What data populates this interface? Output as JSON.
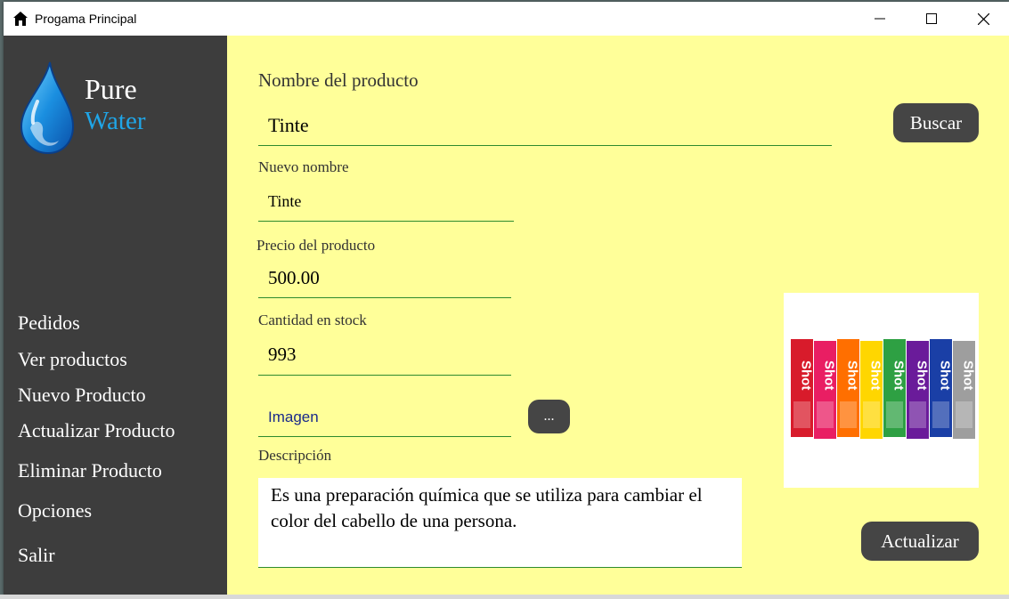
{
  "window": {
    "title": "Progama Principal"
  },
  "logo": {
    "line1": "Pure",
    "line2": "Water"
  },
  "nav": {
    "items": [
      {
        "label": "Pedidos"
      },
      {
        "label": "Ver productos"
      },
      {
        "label": "Nuevo Producto"
      },
      {
        "label": "Actualizar Producto"
      },
      {
        "label": "Eliminar Producto"
      },
      {
        "label": "Opciones"
      },
      {
        "label": "Salir"
      }
    ]
  },
  "form": {
    "product_name_label": "Nombre del producto",
    "product_name_value": "Tinte",
    "search_button": "Buscar",
    "new_name_label": "Nuevo nombre",
    "new_name_value": "Tinte",
    "price_label": "Precio del producto",
    "price_value": "500.00",
    "stock_label": "Cantidad en stock",
    "stock_value": "993",
    "image_field_value": "Imagen",
    "browse_button": "...",
    "description_label": "Descripción",
    "description_value": "Es una preparación química que se utiliza para cambiar el color del cabello de una persona.",
    "update_button": "Actualizar"
  },
  "product_image": {
    "brand_text": "Shot",
    "tube_colors": [
      "#d81b2b",
      "#e91e63",
      "#ff6f00",
      "#ffd600",
      "#2ea043",
      "#6a1b9a",
      "#1a3fa6",
      "#9e9e9e"
    ]
  },
  "colors": {
    "sidebar_bg": "#3d3d3d",
    "main_bg": "#ffff99",
    "button_bg": "#454545",
    "accent_blue": "#1fa6e8",
    "underline_green": "#2e8b2e"
  }
}
